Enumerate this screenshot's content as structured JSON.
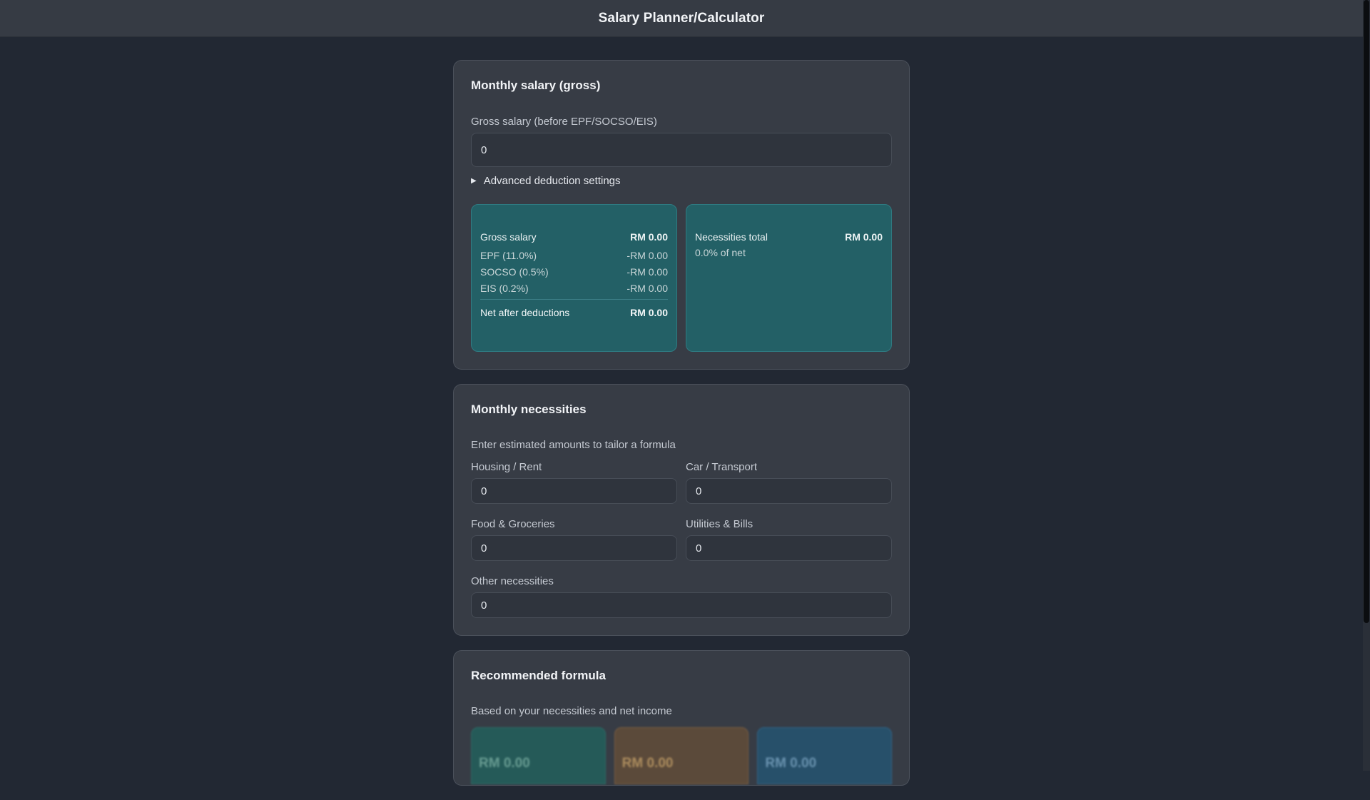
{
  "app": {
    "title": "Salary Planner/Calculator"
  },
  "salary_card": {
    "title": "Monthly salary (gross)",
    "gross_label": "Gross salary (before EPF/SOCSO/EIS)",
    "gross_value": "0",
    "advanced_label": "Advanced deduction settings",
    "breakdown": {
      "gross_label": "Gross salary",
      "gross_value": "RM 0.00",
      "epf_label": "EPF (11.0%)",
      "epf_value": "-RM 0.00",
      "socso_label": "SOCSO (0.5%)",
      "socso_value": "-RM 0.00",
      "eis_label": "EIS (0.2%)",
      "eis_value": "-RM 0.00",
      "net_label": "Net after deductions",
      "net_value": "RM 0.00"
    },
    "necessities_summary": {
      "label": "Necessities total",
      "value": "RM 0.00",
      "percent_text": "0.0% of net"
    }
  },
  "necessities_card": {
    "title": "Monthly necessities",
    "hint": "Enter estimated amounts to tailor a formula",
    "fields": {
      "housing": {
        "label": "Housing / Rent",
        "value": "0"
      },
      "transport": {
        "label": "Car / Transport",
        "value": "0"
      },
      "food": {
        "label": "Food & Groceries",
        "value": "0"
      },
      "utilities": {
        "label": "Utilities & Bills",
        "value": "0"
      },
      "other": {
        "label": "Other necessities",
        "value": "0"
      }
    }
  },
  "formula_card": {
    "title": "Recommended formula",
    "hint": "Based on your necessities and net income",
    "boxes": [
      {
        "value": "RM 0.00",
        "color": "#255a58"
      },
      {
        "value": "RM 0.00",
        "color": "#5b4a3a"
      },
      {
        "value": "RM 0.00",
        "color": "#27506a"
      }
    ]
  },
  "colors": {
    "background": "#222833",
    "card": "#373c45",
    "summary_teal": "#236066"
  }
}
